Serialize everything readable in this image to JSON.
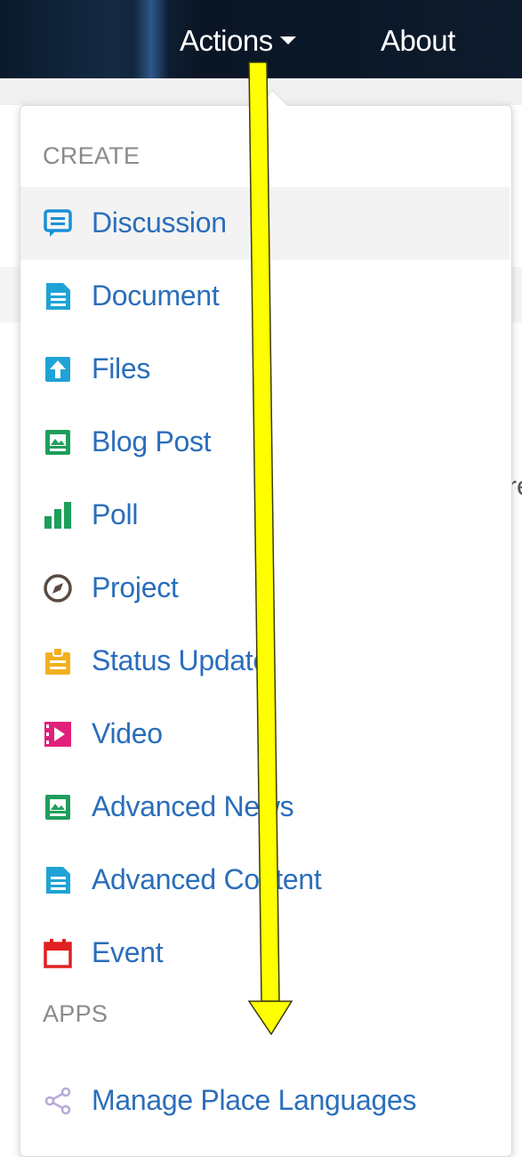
{
  "nav": {
    "actions_label": "Actions",
    "about_label": "About"
  },
  "background_text": "re",
  "menu": {
    "create_heading": "CREATE",
    "apps_heading": "APPS",
    "create_items": [
      {
        "label": "Discussion",
        "icon": "discussion-icon",
        "color": "#1a8fd8"
      },
      {
        "label": "Document",
        "icon": "document-icon",
        "color": "#1fa3d6"
      },
      {
        "label": "Files",
        "icon": "file-upload-icon",
        "color": "#1fa3d6"
      },
      {
        "label": "Blog Post",
        "icon": "blog-post-icon",
        "color": "#1e9e5b"
      },
      {
        "label": "Poll",
        "icon": "poll-icon",
        "color": "#1e9e5b"
      },
      {
        "label": "Project",
        "icon": "project-icon",
        "color": "#5a4a42"
      },
      {
        "label": "Status Update",
        "icon": "status-update-icon",
        "color": "#f2b01e"
      },
      {
        "label": "Video",
        "icon": "video-icon",
        "color": "#e0207a"
      },
      {
        "label": "Advanced News",
        "icon": "advanced-news-icon",
        "color": "#1e9e5b"
      },
      {
        "label": "Advanced Content",
        "icon": "advanced-content-icon",
        "color": "#1fa3d6"
      },
      {
        "label": "Event",
        "icon": "event-icon",
        "color": "#e02020"
      }
    ],
    "app_items": [
      {
        "label": "Manage Place Languages",
        "icon": "share-icon",
        "color": "#b9a9d8"
      }
    ]
  },
  "annotation": {
    "arrow_color": "#ffff00"
  }
}
